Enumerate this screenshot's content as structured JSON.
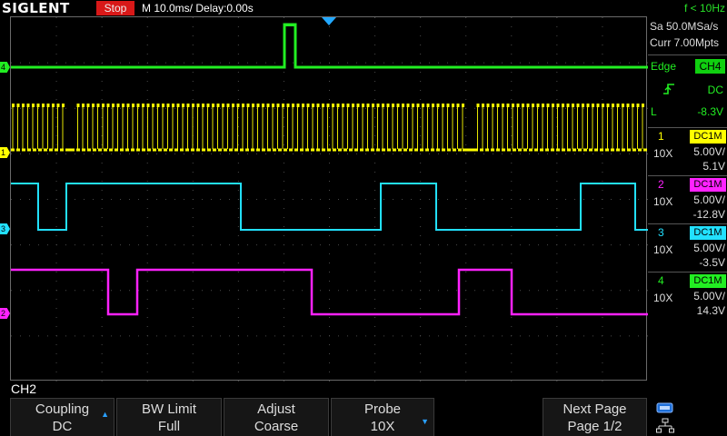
{
  "header": {
    "logo": "SIGLENT",
    "run_state": "Stop",
    "timebase": "M 10.0ms/ Delay:0.00s",
    "frequency": "f < 10Hz"
  },
  "acquisition": {
    "sample_rate": "Sa 50.0MSa/s",
    "memory_depth": "Curr 7.00Mpts"
  },
  "trigger": {
    "type": "Edge",
    "source": "CH4",
    "coupling": "DC",
    "level_label": "L",
    "level": "-8.3V"
  },
  "channels": [
    {
      "num": "1",
      "coupling": "DC1M",
      "probe": "10X",
      "scale": "5.00V/",
      "offset": "5.1V",
      "color": "#ffff00"
    },
    {
      "num": "2",
      "coupling": "DC1M",
      "probe": "10X",
      "scale": "5.00V/",
      "offset": "-12.8V",
      "color": "#ff22ff"
    },
    {
      "num": "3",
      "coupling": "DC1M",
      "probe": "10X",
      "scale": "5.00V/",
      "offset": "-3.5V",
      "color": "#22e0ff"
    },
    {
      "num": "4",
      "coupling": "DC1M",
      "probe": "10X",
      "scale": "5.00V/",
      "offset": "14.3V",
      "color": "#22ee22"
    }
  ],
  "trace_markers": [
    "4",
    "1",
    "3",
    "2"
  ],
  "menu": {
    "channel": "CH2",
    "softkeys": [
      {
        "line1": "Coupling",
        "line2": "DC"
      },
      {
        "line1": "BW Limit",
        "line2": "Full"
      },
      {
        "line1": "Adjust",
        "line2": "Coarse"
      },
      {
        "line1": "Probe",
        "line2": "10X"
      },
      {
        "line1": "Next Page",
        "line2": "Page 1/2"
      }
    ]
  },
  "icons": [
    "trigger-position-icon",
    "rising-edge-icon",
    "usb-icon",
    "network-icon"
  ]
}
